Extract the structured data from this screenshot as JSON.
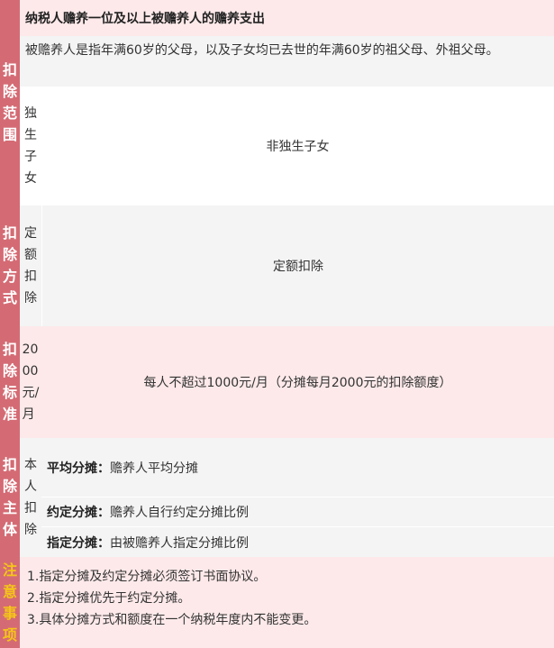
{
  "sections": {
    "scope": {
      "label": "扣\n除\n范\n围",
      "title": "纳税人赡养一位及以上被赡养人的赡养支出",
      "definition": "被赡养人是指年满60岁的父母，以及子女均已去世的年满60岁的祖父母、外祖父母。",
      "only_child_label": "独\n生\n子\n女",
      "non_only_child_label": "非独生子女"
    },
    "method": {
      "label": "扣\n除\n方\n式",
      "sub_label": "定\n额\n扣\n除",
      "value": "定额扣除"
    },
    "standard": {
      "label": "扣\n除\n标\n准",
      "sub_label": "20\n00\n元/\n月",
      "value": "每人不超过1000元/月（分摊每月2000元的扣除额度）"
    },
    "subject": {
      "label": "扣\n除\n主\n体",
      "sub_label": "本\n人\n扣\n除",
      "rows": [
        {
          "name": "平均分摊：",
          "desc": "赡养人平均分摊"
        },
        {
          "name": "约定分摊：",
          "desc": "赡养人自行约定分摊比例"
        },
        {
          "name": "指定分摊：",
          "desc": "由被赡养人指定分摊比例"
        }
      ]
    },
    "notes": {
      "label": "注\n意\n事\n项",
      "items": [
        "1.指定分摊及约定分摊必须签订书面协议。",
        "2.指定分摊优先于约定分摊。",
        "3.具体分摊方式和额度在一个纳税年度内不能变更。"
      ]
    }
  }
}
